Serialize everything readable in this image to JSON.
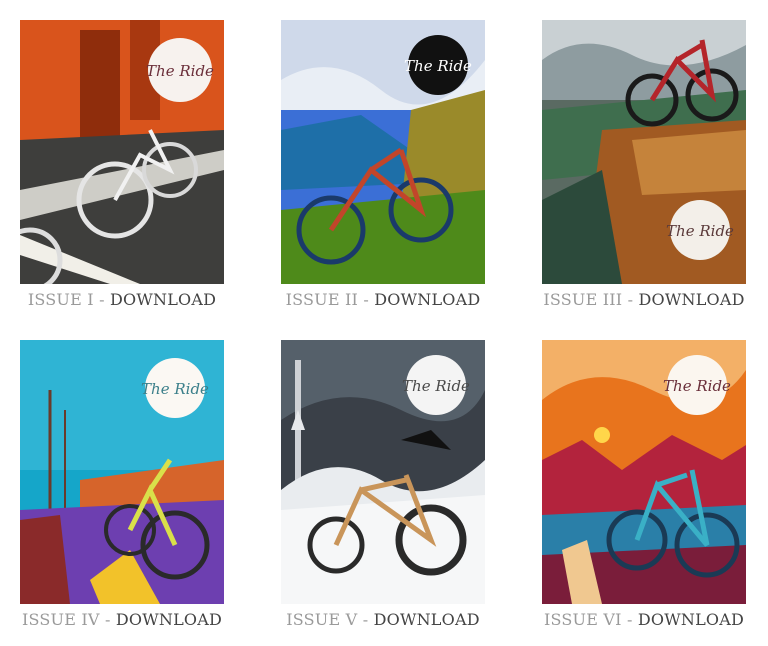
{
  "issues": [
    {
      "label": "ISSUE I",
      "separator": " - ",
      "action": "DOWNLOAD",
      "logo": "The Ride",
      "image": "cover-issue-1",
      "palette": {
        "bg": "#c2410c",
        "accent": "#f97316",
        "ground": "#3f3f3f"
      }
    },
    {
      "label": "ISSUE II",
      "separator": " - ",
      "action": "DOWNLOAD",
      "logo": "The Ride",
      "image": "cover-issue-2",
      "palette": {
        "bg": "#2563eb",
        "accent": "#d97706",
        "ground": "#4d7c0f"
      }
    },
    {
      "label": "ISSUE III",
      "separator": " - ",
      "action": "DOWNLOAD",
      "logo": "The Ride",
      "image": "cover-issue-3",
      "palette": {
        "bg": "#6b7280",
        "accent": "#b45309",
        "ground": "#92400e"
      }
    },
    {
      "label": "ISSUE IV",
      "separator": " - ",
      "action": "DOWNLOAD",
      "logo": "The Ride",
      "image": "cover-issue-4",
      "palette": {
        "bg": "#0ea5c6",
        "accent": "#facc15",
        "ground": "#7c3aed"
      }
    },
    {
      "label": "ISSUE V",
      "separator": " - ",
      "action": "DOWNLOAD",
      "logo": "The Ride",
      "image": "cover-issue-5",
      "palette": {
        "bg": "#374151",
        "accent": "#d4a373",
        "ground": "#f3f4f6"
      }
    },
    {
      "label": "ISSUE VI",
      "separator": " - ",
      "action": "DOWNLOAD",
      "logo": "The Ride",
      "image": "cover-issue-6",
      "palette": {
        "bg": "#ea580c",
        "accent": "#38bdf8",
        "ground": "#9f1239"
      }
    }
  ]
}
